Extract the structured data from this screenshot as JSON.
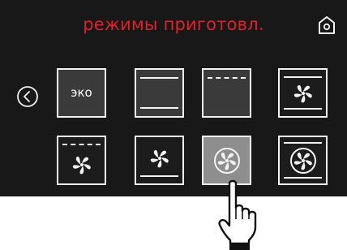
{
  "header": {
    "title": "режимы приготовл.",
    "title_color": "#e0202a"
  },
  "modes": {
    "row1": [
      {
        "label": "эко",
        "icon": "text-label"
      },
      {
        "label": "",
        "icon": "top-bottom-heat-icon"
      },
      {
        "label": "",
        "icon": "grill-icon"
      },
      {
        "label": "",
        "icon": "fan-top-bottom-icon"
      }
    ],
    "row2": [
      {
        "label": "",
        "icon": "fan-grill-icon"
      },
      {
        "label": "",
        "icon": "fan-bottom-icon"
      },
      {
        "label": "",
        "icon": "ring-fan-icon",
        "selected": true
      },
      {
        "label": "",
        "icon": "ring-fan-top-bottom-icon"
      }
    ]
  },
  "icons": {
    "home": "home-icon",
    "back": "chevron-left-circle-icon",
    "pointer": "pointing-hand-icon"
  },
  "colors": {
    "screen_bg": "#181818",
    "tile_border": "#f2f2f2",
    "selected_tile": "#8e8e8e"
  }
}
